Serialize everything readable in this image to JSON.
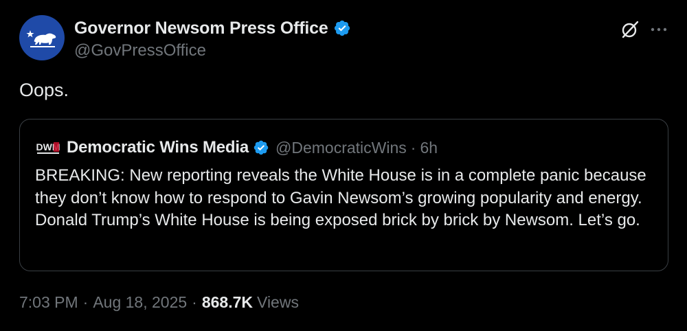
{
  "tweet": {
    "author": {
      "display_name": "Governor Newsom Press Office",
      "handle": "@GovPressOffice",
      "verified": true,
      "avatar_icon": "california-bear-flag-icon",
      "avatar_color": "#1f4aa8"
    },
    "text": "Oops.",
    "quoted": {
      "author_display_name": "Democratic Wins Media",
      "author_handle": "@DemocraticWins",
      "avatar_icon": "dwm-logo-icon",
      "avatar_text": "DWM",
      "separator": "·",
      "relative_time": "6h",
      "text": "BREAKING: New reporting reveals the White House is in a complete panic because they don’t know how to respond to Gavin Newsom’s growing popularity and energy. Donald Trump’s White House is being exposed brick by brick by Newsom. Let’s go."
    },
    "meta": {
      "time": "7:03 PM",
      "separator": "·",
      "date": "Aug 18, 2025",
      "views_count": "868.7K",
      "views_label": "Views"
    }
  },
  "icons": {
    "verified": "verified-badge-icon",
    "grok": "grok-icon",
    "more": "more-icon"
  },
  "colors": {
    "background": "#000000",
    "text_primary": "#e7e9ea",
    "text_secondary": "#71767b",
    "verified_blue": "#1d9bf0",
    "border": "#3a3f44"
  }
}
